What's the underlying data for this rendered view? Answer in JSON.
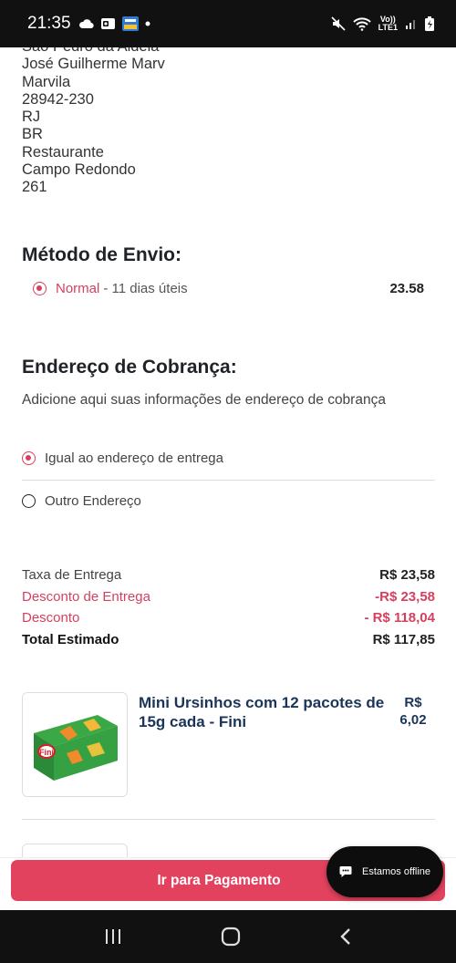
{
  "status_bar": {
    "time": "21:35",
    "left_icons": [
      "cloud-icon",
      "outlook-icon",
      "gov-app-icon",
      "dot-icon"
    ],
    "right_icons": [
      "mute-icon",
      "wifi-icon",
      "volte-icon",
      "signal-icon",
      "battery-icon"
    ],
    "volte_text_1": "Vo))",
    "volte_text_2": "LTE1"
  },
  "address": {
    "lines": [
      "São Pedro da Aldeia",
      "José Guilherme Marv",
      "Marvila",
      "28942-230",
      "RJ",
      "BR",
      "Restaurante",
      "Campo Redondo",
      "261"
    ]
  },
  "shipping": {
    "title": "Método de Envio:",
    "option_name": "Normal",
    "option_days": "- 11 dias úteis",
    "option_price": "23.58",
    "selected": true
  },
  "billing": {
    "title": "Endereço de Cobrança:",
    "description": "Adicione aqui suas informações de endereço de cobrança",
    "option_same": "Igual ao endereço de entrega",
    "option_other": "Outro Endereço",
    "selected": "same"
  },
  "summary": {
    "delivery_fee_label": "Taxa de Entrega",
    "delivery_fee_value": "R$ 23,58",
    "delivery_discount_label": "Desconto de Entrega",
    "delivery_discount_value": "-R$ 23,58",
    "discount_label": "Desconto",
    "discount_value": "- R$ 118,04",
    "total_label": "Total Estimado",
    "total_value": "R$ 117,85"
  },
  "product": {
    "name": "Mini Ursinhos com 12 pacotes de 15g cada - Fini",
    "price_currency": "R$",
    "price_value": "6,02",
    "brand_logo": "Fini"
  },
  "checkout": {
    "pay_label": "Ir para Pagamento"
  },
  "chat": {
    "label": "Estamos offline"
  },
  "colors": {
    "accent": "#e3425e",
    "accent_text": "#d6405f",
    "product_title": "#1a3559"
  }
}
